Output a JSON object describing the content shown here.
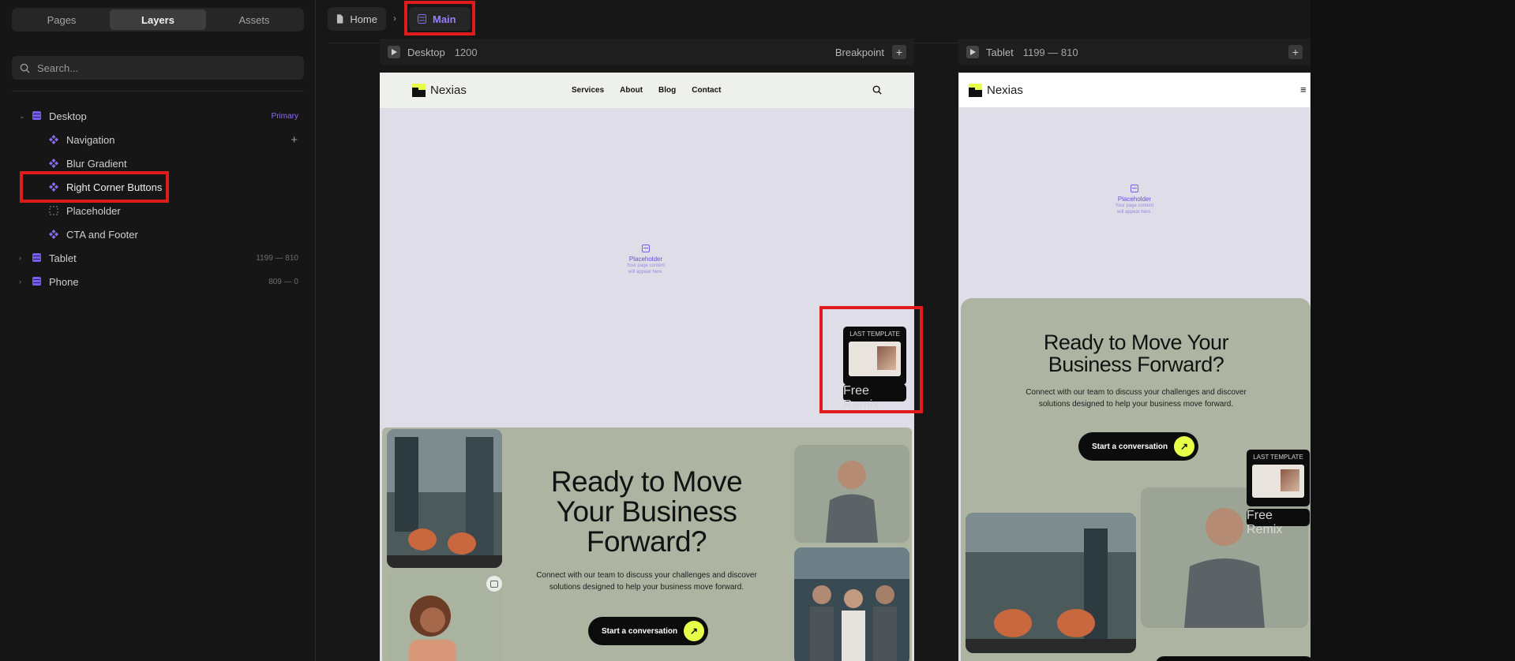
{
  "left_panel": {
    "tabs": [
      {
        "label": "Pages",
        "active": false
      },
      {
        "label": "Layers",
        "active": true
      },
      {
        "label": "Assets",
        "active": false
      }
    ],
    "search": {
      "placeholder": "Search..."
    },
    "layers": {
      "desktop": {
        "label": "Desktop",
        "tag": "Primary"
      },
      "children": [
        "Navigation",
        "Blur Gradient",
        "Right Corner Buttons",
        "Placeholder",
        "CTA and Footer"
      ],
      "tablet": {
        "label": "Tablet",
        "range": "1199 — 810"
      },
      "phone": {
        "label": "Phone",
        "range": "809 — 0"
      }
    }
  },
  "breadcrumb": {
    "home": "Home",
    "current": "Main"
  },
  "frames": {
    "desktop": {
      "label": "Desktop",
      "width": "1200",
      "action": "Breakpoint"
    },
    "tablet": {
      "label": "Tablet",
      "range": "1199 — 810"
    }
  },
  "site": {
    "brand": "Nexias",
    "nav": [
      "Services",
      "About",
      "Blog",
      "Contact"
    ],
    "placeholder": {
      "title": "Placeholder",
      "line1": "Your page content",
      "line2": "will appear here."
    },
    "cta": {
      "heading_desktop": [
        "Ready to Move",
        "Your Business",
        "Forward?"
      ],
      "heading_tablet": [
        "Ready to Move Your",
        "Business Forward?"
      ],
      "body_desktop": [
        "Connect with our team to discuss your challenges and discover",
        "solutions designed to help your business move forward."
      ],
      "body_tablet": [
        "Connect with our team to discuss your challenges and discover",
        "solutions designed to help your business move forward."
      ],
      "button": "Start a conversation"
    },
    "last_template": {
      "title": "LAST TEMPLATE",
      "button": "Free Remix"
    }
  },
  "colors": {
    "accent": "#7b5cf0",
    "highlight": "#e01b1b",
    "cta_bg": "#adb5a2",
    "lime": "#e8ff4a"
  },
  "icons": [
    "search-icon",
    "page-icon",
    "component-icon",
    "chevron-right-icon",
    "play-icon",
    "plus-icon",
    "arrow-up-right-icon",
    "menu-icon"
  ]
}
